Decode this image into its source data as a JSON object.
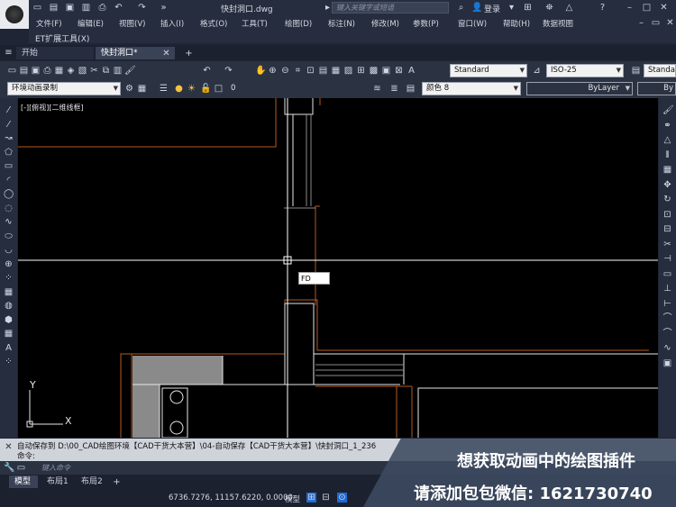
{
  "title_bar": {
    "file_name": "快封洞口.dwg",
    "search_placeholder": "键入关键字或短语",
    "login": "登录"
  },
  "menu": [
    "文件(F)",
    "编辑(E)",
    "视图(V)",
    "插入(I)",
    "格式(O)",
    "工具(T)",
    "绘图(D)",
    "标注(N)",
    "修改(M)",
    "参数(P)",
    "窗口(W)",
    "帮助(H)",
    "数据视图"
  ],
  "et_menu": "ET扩展工具(X)",
  "tabs": {
    "start": "开始",
    "drawing": "快封洞口*"
  },
  "toolbar": {
    "text_style": "Standard",
    "dim_style": "ISO-25",
    "table_style": "Standa",
    "workspace": "环境动画录制",
    "layer": "0",
    "color": "颜色 8",
    "linetype": "ByLayer",
    "lineweight": "By"
  },
  "canvas": {
    "viewport_label": "[-][俯视][二维线框]",
    "ucs_x": "X",
    "ucs_y": "Y",
    "dynamic_input": "FD"
  },
  "command": {
    "history_line1": "自动保存到 D:\\00_CAD绘图环境【CAD干货大本营】\\04-自动保存【CAD干货大本营】\\快封洞口_1_236",
    "history_line2": "命令:",
    "placeholder": "键入命令"
  },
  "layout_tabs": [
    "模型",
    "布局1",
    "布局2"
  ],
  "status": {
    "coordinates": "6736.7276, 11157.6220, 0.0000",
    "mode": "模型"
  },
  "promo": {
    "line1": "想获取动画中的绘图插件",
    "line2": "请添加包包微信: 1621730740"
  },
  "colors": {
    "canvas_bg": "#000000",
    "orange_line": "#b35a1e",
    "white_line": "#e6e6e6",
    "gray_fill": "#8a8a8a"
  }
}
